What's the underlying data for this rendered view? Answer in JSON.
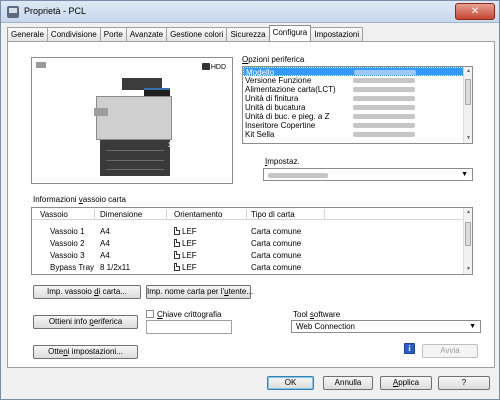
{
  "window": {
    "title": "Proprietà - PCL",
    "close_glyph": "✕"
  },
  "tabs": [
    {
      "label": "Generale"
    },
    {
      "label": "Condivisione"
    },
    {
      "label": "Porte"
    },
    {
      "label": "Avanzate"
    },
    {
      "label": "Gestione colori"
    },
    {
      "label": "Sicurezza"
    },
    {
      "label": "Configura"
    },
    {
      "label": "Impostazioni"
    }
  ],
  "active_tab": "Configura",
  "preview": {
    "hdd_label": "HDD",
    "unit_number": "1"
  },
  "options": {
    "label_pre": "O",
    "label_rest": "pzioni periferica",
    "items": [
      "Modello",
      "Versione Funzione",
      "Alimentazione carta(LCT)",
      "Unità di finitura",
      "Unità di bucatura",
      "Unità di buc. e pieg. a Z",
      "Inseritore Copertine",
      "Kit Sella"
    ],
    "selected_index": 0
  },
  "settings": {
    "label_pre": "I",
    "label_rest": "mpostaz."
  },
  "tray_info": {
    "title_pre": "Informazioni ",
    "title_u": "v",
    "title_rest": "assoio carta",
    "columns": [
      "Vassoio",
      "Dimensione",
      "Orientamento",
      "Tipo di carta"
    ],
    "rows": [
      {
        "tray": "Vassoio 1",
        "size": "A4",
        "orientation": "LEF",
        "type": "Carta comune"
      },
      {
        "tray": "Vassoio 2",
        "size": "A4",
        "orientation": "LEF",
        "type": "Carta comune"
      },
      {
        "tray": "Vassoio 3",
        "size": "A4",
        "orientation": "LEF",
        "type": "Carta comune"
      },
      {
        "tray": "Bypass Tray",
        "size": "8 1/2x11",
        "orientation": "LEF",
        "type": "Carta comune"
      }
    ],
    "btn_tray_pre": "Imp. vassoio ",
    "btn_tray_u": "d",
    "btn_tray_rest": "i carta...",
    "btn_names_pre": "Imp. nome carta per l'",
    "btn_names_u": "u",
    "btn_names_rest": "tente..."
  },
  "bottom": {
    "get_device_pre": "Ottieni info ",
    "get_device_u": "p",
    "get_device_rest": "eriferica",
    "get_settings_pre": "Otte",
    "get_settings_u": "n",
    "get_settings_rest": "i impostazioni...",
    "encryption_pre": "",
    "encryption_u": "C",
    "encryption_rest": "hiave crittografia",
    "encryption_checked": false,
    "software_pre": "Tool ",
    "software_u": "s",
    "software_rest": "oftware",
    "software_value": "Web Connection",
    "info_glyph": "i",
    "launch": "Avvia"
  },
  "footer": {
    "ok": "OK",
    "cancel": "Annulla",
    "apply_pre": "",
    "apply_u": "A",
    "apply_rest": "pplica",
    "help": "?"
  },
  "icons": {
    "dropdown": "▼",
    "scroll_up": "▲",
    "scroll_down": "▼"
  }
}
